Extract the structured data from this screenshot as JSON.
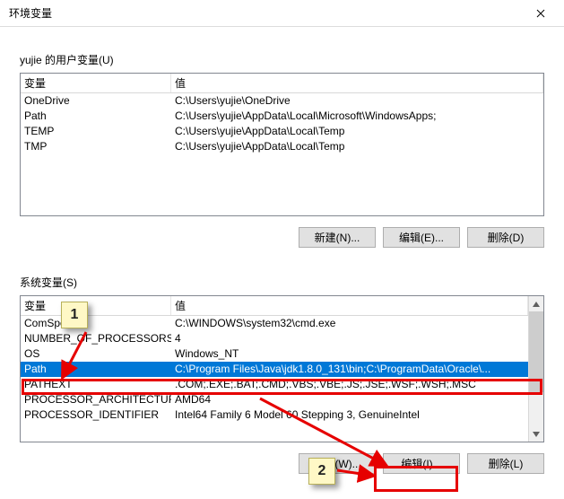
{
  "dialog": {
    "title": "环境变量",
    "close_tooltip": "关闭"
  },
  "user_section": {
    "label": "yujie 的用户变量(U)",
    "headers": {
      "name": "变量",
      "value": "值"
    },
    "rows": [
      {
        "name": "OneDrive",
        "value": "C:\\Users\\yujie\\OneDrive"
      },
      {
        "name": "Path",
        "value": "C:\\Users\\yujie\\AppData\\Local\\Microsoft\\WindowsApps;"
      },
      {
        "name": "TEMP",
        "value": "C:\\Users\\yujie\\AppData\\Local\\Temp"
      },
      {
        "name": "TMP",
        "value": "C:\\Users\\yujie\\AppData\\Local\\Temp"
      }
    ],
    "buttons": {
      "new": "新建(N)...",
      "edit": "编辑(E)...",
      "delete": "删除(D)"
    }
  },
  "system_section": {
    "label": "系统变量(S)",
    "headers": {
      "name": "变量",
      "value": "值"
    },
    "rows": [
      {
        "name": "ComSpec",
        "value": "C:\\WINDOWS\\system32\\cmd.exe"
      },
      {
        "name": "NUMBER_OF_PROCESSORS",
        "value": "4"
      },
      {
        "name": "OS",
        "value": "Windows_NT"
      },
      {
        "name": "Path",
        "value": "C:\\Program Files\\Java\\jdk1.8.0_131\\bin;C:\\ProgramData\\Oracle\\...",
        "selected": true
      },
      {
        "name": "PATHEXT",
        "value": ".COM;.EXE;.BAT;.CMD;.VBS;.VBE;.JS;.JSE;.WSF;.WSH;.MSC"
      },
      {
        "name": "PROCESSOR_ARCHITECTURE",
        "value": "AMD64"
      },
      {
        "name": "PROCESSOR_IDENTIFIER",
        "value": "Intel64 Family 6 Model 60 Stepping 3, GenuineIntel"
      }
    ],
    "buttons": {
      "new": "新建(W)...",
      "edit": "编辑(I)...",
      "delete": "删除(L)"
    }
  },
  "annotations": {
    "callout1": "1",
    "callout2": "2"
  }
}
